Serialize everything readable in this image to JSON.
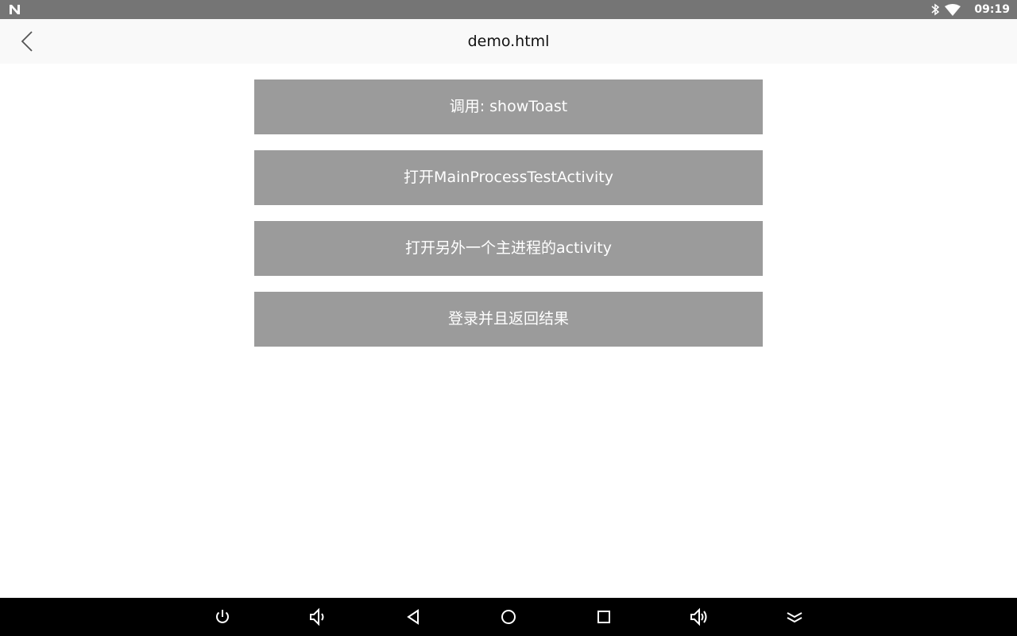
{
  "status_bar": {
    "clock": "09:19",
    "icons": [
      "n-notification-icon",
      "bluetooth-icon",
      "wifi-icon"
    ]
  },
  "app_bar": {
    "title": "demo.html",
    "back_icon": "back-arrow-icon"
  },
  "buttons": [
    {
      "label": "调用: showToast"
    },
    {
      "label": "打开MainProcessTestActivity"
    },
    {
      "label": "打开另外一个主进程的activity"
    },
    {
      "label": "登录并且返回结果"
    }
  ],
  "nav_bar": {
    "icons": [
      "power-icon",
      "volume-down-icon",
      "back-icon",
      "home-icon",
      "recents-icon",
      "volume-up-icon",
      "hide-nav-icon"
    ]
  },
  "colors": {
    "status_bar": "#757575",
    "app_bar": "#f9f9f9",
    "button": "#9b9b9b",
    "nav_bar": "#000000"
  }
}
